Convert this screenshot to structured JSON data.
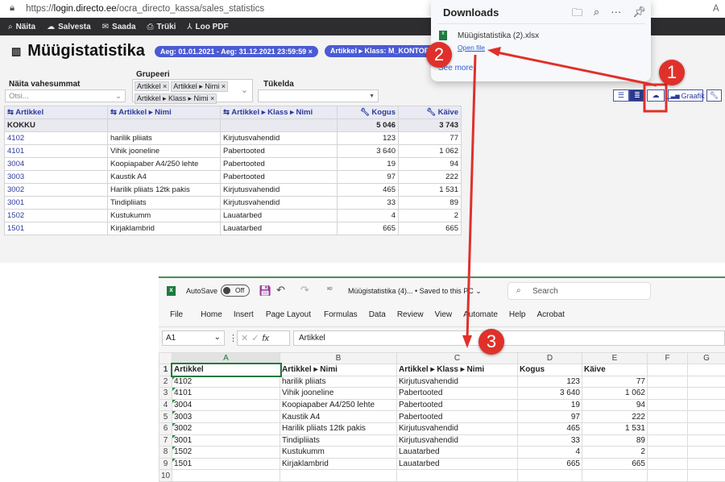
{
  "browser": {
    "url_prefix": "https://",
    "url_host": "login.directo.ee",
    "url_path": "/ocra_directo_kassa/sales_statistics",
    "right_label": "A"
  },
  "toolbar": {
    "items": [
      {
        "icon": "search-icon",
        "label": "Näita"
      },
      {
        "icon": "cloud-upload-icon",
        "label": "Salvesta"
      },
      {
        "icon": "mail-icon",
        "label": "Saada"
      },
      {
        "icon": "printer-icon",
        "label": "Trüki"
      },
      {
        "icon": "pdf-icon",
        "label": "Loo PDF"
      }
    ]
  },
  "page": {
    "title": "Müügistatistika",
    "chips": [
      "Aeg: 01.01.2021 - Aeg: 31.12.2021 23:59:59 ×",
      "Artikkel ▸ Klass: M_KONTOR ×"
    ]
  },
  "filters": {
    "subtotals_label": "Näita vahesummat",
    "subtotals_placeholder": "Otsi...",
    "group_label": "Grupeeri",
    "group_tags": [
      "Artikkel ×",
      "Artikkel ▸ Nimi ×",
      "Artikkel ▸ Klass ▸ Nimi ×"
    ],
    "split_label": "Tükelda"
  },
  "view": {
    "graph_label": "Graafik"
  },
  "table": {
    "headers": [
      "Artikkel",
      "Artikkel ▸ Nimi",
      "Artikkel ▸ Klass ▸ Nimi",
      "Kogus",
      "Käive"
    ],
    "total": [
      "KOKKU",
      "",
      "",
      "5 046",
      "3 743"
    ],
    "rows": [
      [
        "4102",
        "harilik pliiats",
        "Kirjutusvahendid",
        "123",
        "77"
      ],
      [
        "4101",
        "Vihik jooneline",
        "Pabertooted",
        "3 640",
        "1 062"
      ],
      [
        "3004",
        "Koopiapaber A4/250 lehte",
        "Pabertooted",
        "19",
        "94"
      ],
      [
        "3003",
        "Kaustik A4",
        "Pabertooted",
        "97",
        "222"
      ],
      [
        "3002",
        "Harilik pliiats 12tk pakis",
        "Kirjutusvahendid",
        "465",
        "1 531"
      ],
      [
        "3001",
        "Tindipliiats",
        "Kirjutusvahendid",
        "33",
        "89"
      ],
      [
        "1502",
        "Kustukumm",
        "Lauatarbed",
        "4",
        "2"
      ],
      [
        "1501",
        "Kirjaklambrid",
        "Lauatarbed",
        "665",
        "665"
      ]
    ]
  },
  "downloads": {
    "title": "Downloads",
    "file": "Müügistatistika (2).xlsx",
    "open": "Open file",
    "more": "See more"
  },
  "excel": {
    "autosave": "AutoSave",
    "toggle": "Off",
    "doc": "Müügistatistika (4)... • Saved to this PC ⌄",
    "search": "Search",
    "menu": [
      "File",
      "Home",
      "Insert",
      "Page Layout",
      "Formulas",
      "Data",
      "Review",
      "View",
      "Automate",
      "Help",
      "Acrobat"
    ],
    "namebox": "A1",
    "formula": "Artikkel",
    "cols": [
      "A",
      "B",
      "C",
      "D",
      "E",
      "F",
      "G"
    ],
    "rows": [
      [
        "Artikkel",
        "Artikkel ▸ Nimi",
        "Artikkel ▸ Klass ▸ Nimi",
        "Kogus",
        "Käive"
      ],
      [
        "4102",
        "harilik pliiats",
        "Kirjutusvahendid",
        "123",
        "77"
      ],
      [
        "4101",
        "Vihik jooneline",
        "Pabertooted",
        "3 640",
        "1 062"
      ],
      [
        "3004",
        "Koopiapaber A4/250 lehte",
        "Pabertooted",
        "19",
        "94"
      ],
      [
        "3003",
        "Kaustik A4",
        "Pabertooted",
        "97",
        "222"
      ],
      [
        "3002",
        "Harilik pliiats 12tk pakis",
        "Kirjutusvahendid",
        "465",
        "1 531"
      ],
      [
        "3001",
        "Tindipliiats",
        "Kirjutusvahendid",
        "33",
        "89"
      ],
      [
        "1502",
        "Kustukumm",
        "Lauatarbed",
        "4",
        "2"
      ],
      [
        "1501",
        "Kirjaklambrid",
        "Lauatarbed",
        "665",
        "665"
      ],
      [
        "",
        "",
        "",
        "",
        ""
      ]
    ]
  },
  "annotations": {
    "steps": [
      "1",
      "2",
      "3"
    ],
    "color": "#e0302a"
  }
}
